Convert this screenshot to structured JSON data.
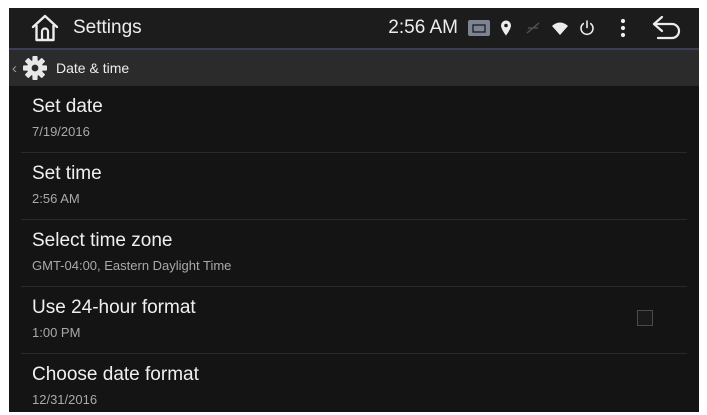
{
  "status_bar": {
    "title": "Settings",
    "time": "2:56 AM",
    "icons": [
      "home-icon",
      "screen-icon",
      "location-icon",
      "signal-icon",
      "wifi-icon",
      "power-icon",
      "overflow-menu-icon",
      "back-arrow-icon"
    ]
  },
  "breadcrumb": {
    "title": "Date & time",
    "icon": "gear-icon"
  },
  "settings": {
    "items": [
      {
        "title": "Set date",
        "subtitle": "7/19/2016"
      },
      {
        "title": "Set time",
        "subtitle": "2:56 AM"
      },
      {
        "title": "Select time zone",
        "subtitle": "GMT-04:00, Eastern Daylight Time"
      },
      {
        "title": "Use 24-hour format",
        "subtitle": "1:00 PM",
        "checked": false
      },
      {
        "title": "Choose date format",
        "subtitle": "12/31/2016"
      }
    ]
  },
  "colors": {
    "background": "#141414",
    "status_bar": "#1c1c1c",
    "breadcrumb_bar": "#2b2b2b",
    "primary_text": "#f0f0f0",
    "secondary_text": "#a9a9a9"
  }
}
